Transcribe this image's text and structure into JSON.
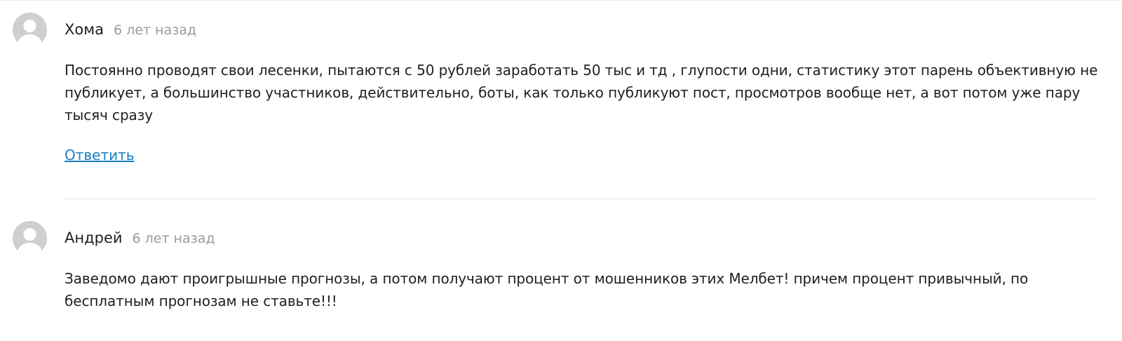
{
  "comments": [
    {
      "author": "Хома",
      "date": "6 лет назад",
      "text": "Постоянно проводят свои лесенки, пытаются с 50 рублей заработать 50 тыс и тд , глупости одни, статистику этот парень объективную не публикует, а большинство участников, действительно, боты, как только публикуют пост, просмотров вообще нет, а вот потом уже пару тысяч сразу",
      "reply_label": "Ответить"
    },
    {
      "author": "Андрей",
      "date": "6 лет назад",
      "text": "Заведомо дают проигрышные прогнозы, а потом получают процент от мошенников этих Мелбет! причем процент привычный, по бесплатным прогнозам не ставьте!!!"
    }
  ],
  "colors": {
    "link": "#1b7ec2",
    "date": "#9a9a9a",
    "avatar": "#cfcfcf"
  },
  "icons": {
    "avatar": "default-user-icon"
  }
}
